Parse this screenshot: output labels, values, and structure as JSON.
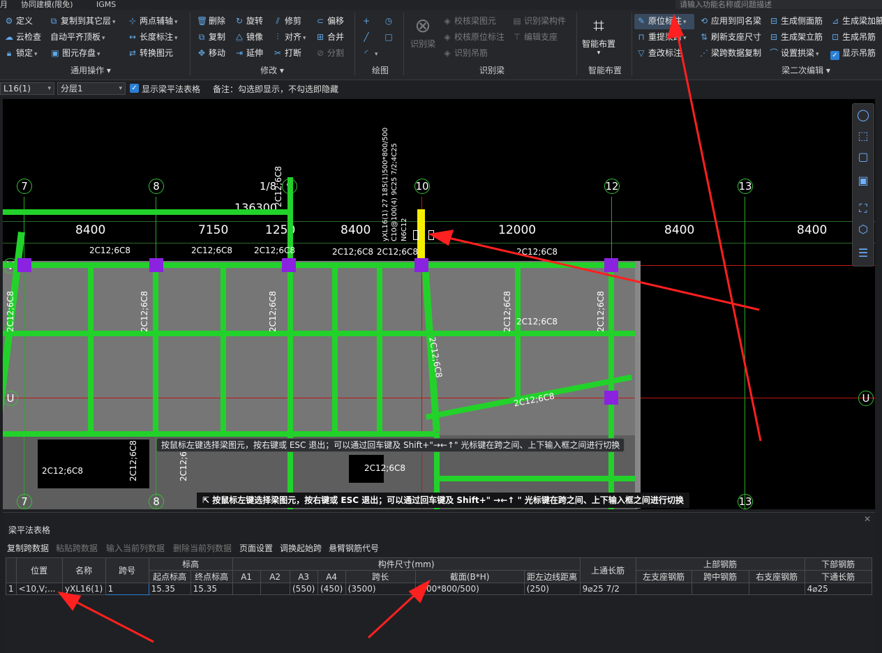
{
  "menubar": {
    "items": [
      "月",
      "协同建模(限免)",
      "IGMS"
    ],
    "search_placeholder": "请输入功能名称或问题描述"
  },
  "ribbon": {
    "general": {
      "group_label": "通用操作",
      "items": [
        "定义",
        "复制到其它层",
        "两点辅轴",
        "云检查",
        "自动平齐顶板",
        "长度标注",
        "锁定",
        "图元存盘",
        "转换图元"
      ]
    },
    "modify": {
      "group_label": "修改",
      "items": [
        "删除",
        "旋转",
        "修剪",
        "偏移",
        "复制",
        "镜像",
        "对齐",
        "合并",
        "移动",
        "延伸",
        "打断",
        "分割"
      ]
    },
    "draw": {
      "group_label": "绘图"
    },
    "recognize": {
      "group_label": "识别梁",
      "big": "识别梁",
      "items": [
        "校核梁图元",
        "识别梁构件",
        "校核原位标注",
        "编辑支座",
        "识别吊筋"
      ]
    },
    "smart": {
      "group_label": "智能布置",
      "big": "智能布置"
    },
    "secondary": {
      "group_label": "梁二次编辑",
      "items": [
        "原位标注",
        "应用到同名梁",
        "生成侧面筋",
        "生成梁加腋",
        "重提梁跨",
        "刷新支座尺寸",
        "生成架立筋",
        "生成吊筋",
        "查改标注",
        "梁跨数据复制",
        "设置拱梁",
        "显示吊筋"
      ]
    }
  },
  "toolbar2": {
    "beam_select": "L16(1)",
    "floor_select": "分层1",
    "show_table_label": "显示梁平法表格",
    "note": "备注：勾选即显示，不勾选即隐藏"
  },
  "canvas": {
    "axes": [
      "7",
      "8",
      "1/8",
      "9",
      "10",
      "12",
      "13"
    ],
    "row_axes": [
      "V",
      "U"
    ],
    "bottom_axes": [
      "7",
      "8",
      "13"
    ],
    "dims": [
      "8400",
      "7150",
      "1250",
      "8400",
      "12000",
      "8400",
      "8400"
    ],
    "elev_label": "136300",
    "beam_label": "2C12;6C8",
    "vertical_annotation": "yXL16(1) 27 185(1)500*800/500",
    "vertical_annotation2": "C10@100(4) 9C25 7/2;4C25",
    "vertical_annotation3": "N6C12",
    "label_1_8": "1/8",
    "label_2c12_6c8": "2C12;6C8",
    "tooltip": "按鼠标左键选择梁图元，按右键或 ESC 退出；可以通过回车键及 Shift+\"→←↑\" 光标键在跨之间、上下输入框之间进行切换",
    "status": "按鼠标左键选择梁图元，按右键或 ESC 退出；可以通过回车键及 Shift+\" →←↑ \" 光标键在跨之间、上下输入框之间进行切换"
  },
  "panel": {
    "title": "梁平法表格",
    "toolbar": [
      {
        "label": "复制跨数据",
        "enabled": true
      },
      {
        "label": "粘贴跨数据",
        "enabled": false
      },
      {
        "label": "输入当前列数据",
        "enabled": false
      },
      {
        "label": "删除当前列数据",
        "enabled": false
      },
      {
        "label": "页面设置",
        "enabled": true
      },
      {
        "label": "调换起始跨",
        "enabled": true
      },
      {
        "label": "悬臂钢筋代号",
        "enabled": true
      }
    ],
    "headers": {
      "position": "位置",
      "name": "名称",
      "span_no": "跨号",
      "elevation": "标高",
      "elev_start": "起点标高",
      "elev_end": "终点标高",
      "size": "构件尺寸(mm)",
      "a1": "A1",
      "a2": "A2",
      "a3": "A3",
      "a4": "A4",
      "span_len": "跨长",
      "section": "截面(B*H)",
      "edge_dist": "距左边线距离",
      "top_through": "上通长筋",
      "top_bars": "上部钢筋",
      "left_support": "左支座钢筋",
      "mid_span": "跨中钢筋",
      "right_support": "右支座钢筋",
      "bottom_bars": "下部钢筋",
      "bottom_through": "下通长筋"
    },
    "row": {
      "index": "1",
      "position": "<10,V;...",
      "name": "yXL16(1)",
      "span_no": "1",
      "elev_start": "15.35",
      "elev_end": "15.35",
      "a1": "",
      "a2": "",
      "a3": "(550)",
      "a4": "(450)",
      "span_len": "(3500)",
      "section": "(500*800/500)",
      "edge_dist": "(250)",
      "top_through": "9⌀25 7/2",
      "left_support": "",
      "mid_span": "",
      "right_support": "",
      "bottom_through": "4⌀25"
    }
  },
  "colors": {
    "accent": "#2b7fd4",
    "beam": "#22d22a",
    "column": "#8a22e0",
    "arrow": "#ff2020"
  }
}
